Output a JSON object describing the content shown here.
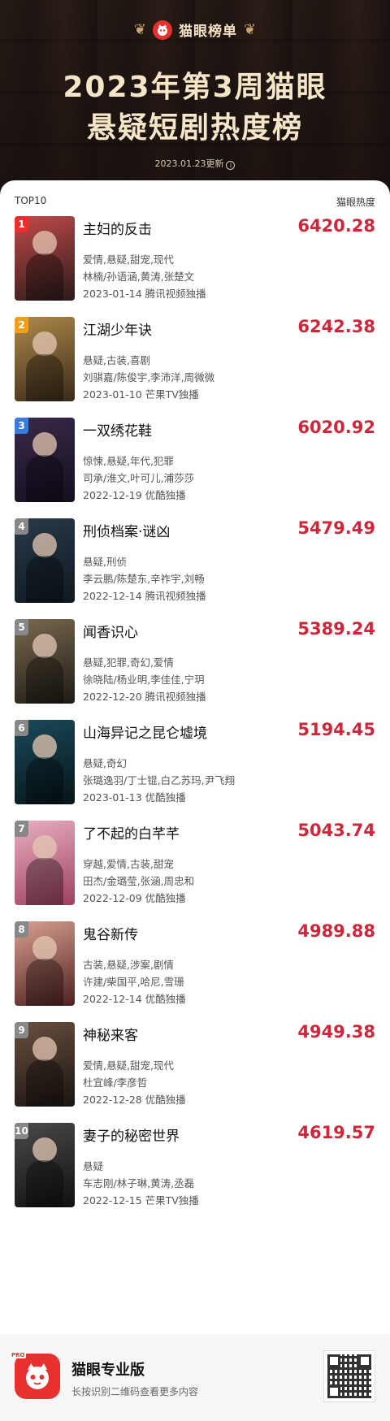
{
  "header": {
    "brand": "猫眼榜单",
    "title_line1": "2023年第3周猫眼",
    "title_line2": "悬疑短剧热度榜",
    "updated": "2023.01.23更新"
  },
  "list": {
    "left_label": "TOP10",
    "right_label": "猫眼热度"
  },
  "items": [
    {
      "rank": "1",
      "name": "主妇的反击",
      "heat": "6420.28",
      "tags": "爱情,悬疑,甜宠,现代",
      "cast": "林楠/孙语涵,黄涛,张楚文",
      "date_platform": "2023-01-14 腾讯视频独播"
    },
    {
      "rank": "2",
      "name": "江湖少年诀",
      "heat": "6242.38",
      "tags": "悬疑,古装,喜剧",
      "cast": "刘骐嘉/陈俊宇,李沛洋,周微微",
      "date_platform": "2023-01-10 芒果TV独播"
    },
    {
      "rank": "3",
      "name": "一双绣花鞋",
      "heat": "6020.92",
      "tags": "惊悚,悬疑,年代,犯罪",
      "cast": "司承/淮文,叶可儿,浦莎莎",
      "date_platform": "2022-12-19 优酷独播"
    },
    {
      "rank": "4",
      "name": "刑侦档案·谜凶",
      "heat": "5479.49",
      "tags": "悬疑,刑侦",
      "cast": "李云鹏/陈楚东,辛祚宇,刘畅",
      "date_platform": "2022-12-14 腾讯视频独播"
    },
    {
      "rank": "5",
      "name": "闻香识心",
      "heat": "5389.24",
      "tags": "悬疑,犯罪,奇幻,爱情",
      "cast": "徐晓陆/杨业明,李佳佳,宁玥",
      "date_platform": "2022-12-20 腾讯视频独播"
    },
    {
      "rank": "6",
      "name": "山海异记之昆仑墟境",
      "heat": "5194.45",
      "tags": "悬疑,奇幻",
      "cast": "张璐逸羽/丁士锟,白乙苏玛,尹飞翔",
      "date_platform": "2023-01-13 优酷独播"
    },
    {
      "rank": "7",
      "name": "了不起的白芊芊",
      "heat": "5043.74",
      "tags": "穿越,爱情,古装,甜宠",
      "cast": "田杰/金璐莹,张涵,周忠和",
      "date_platform": "2022-12-09 优酷独播"
    },
    {
      "rank": "8",
      "name": "鬼谷新传",
      "heat": "4989.88",
      "tags": "古装,悬疑,涉案,剧情",
      "cast": "许建/柴国平,哈尼,雪珊",
      "date_platform": "2022-12-14 优酷独播"
    },
    {
      "rank": "9",
      "name": "神秘来客",
      "heat": "4949.38",
      "tags": "爱情,悬疑,甜宠,现代",
      "cast": "杜宜峰/李彦哲",
      "date_platform": "2022-12-28 优酷独播"
    },
    {
      "rank": "10",
      "name": "妻子的秘密世界",
      "heat": "4619.57",
      "tags": "悬疑",
      "cast": "车志刚/林子琳,黄涛,丞磊",
      "date_platform": "2022-12-15 芒果TV独播"
    }
  ],
  "footer": {
    "title": "猫眼专业版",
    "subtitle": "长按识别二维码查看更多内容",
    "tag": "PRO"
  },
  "colors": {
    "heat": "#d0263a",
    "rank_1": "#e8312f",
    "rank_2": "#f0a020",
    "rank_3": "#3d7bd8",
    "rank_other": "#888888"
  }
}
